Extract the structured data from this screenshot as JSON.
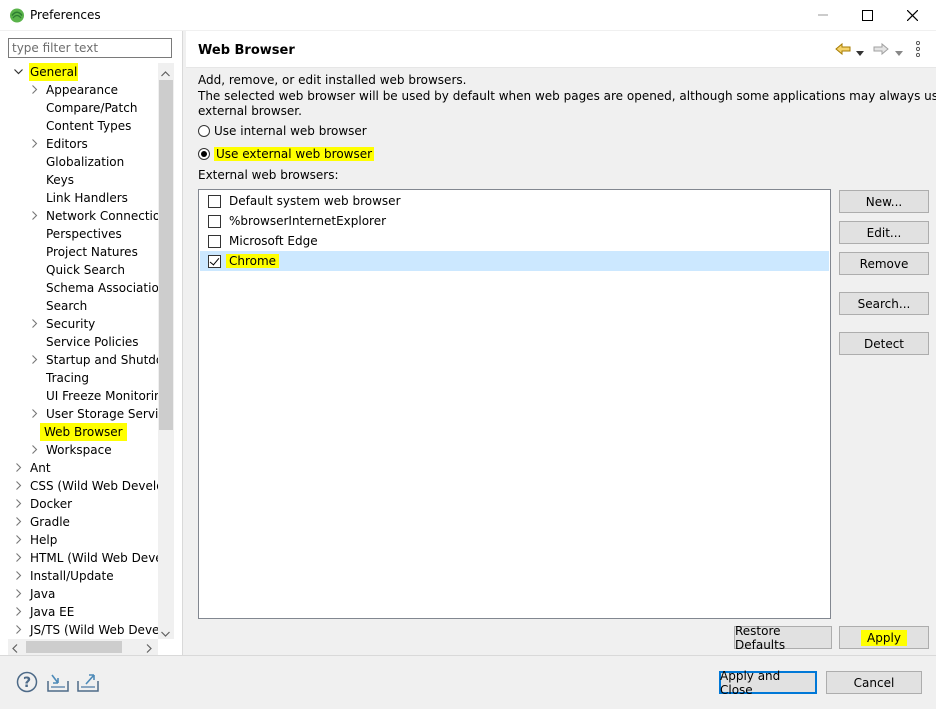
{
  "window": {
    "title": "Preferences"
  },
  "filter": {
    "placeholder": "type filter text"
  },
  "tree": [
    {
      "label": "General",
      "depth": 0,
      "expanded": true,
      "highlight": true
    },
    {
      "label": "Appearance",
      "depth": 1,
      "chevron": true
    },
    {
      "label": "Compare/Patch",
      "depth": 1
    },
    {
      "label": "Content Types",
      "depth": 1
    },
    {
      "label": "Editors",
      "depth": 1,
      "chevron": true
    },
    {
      "label": "Globalization",
      "depth": 1
    },
    {
      "label": "Keys",
      "depth": 1
    },
    {
      "label": "Link Handlers",
      "depth": 1
    },
    {
      "label": "Network Connection",
      "depth": 1,
      "chevron": true
    },
    {
      "label": "Perspectives",
      "depth": 1
    },
    {
      "label": "Project Natures",
      "depth": 1
    },
    {
      "label": "Quick Search",
      "depth": 1
    },
    {
      "label": "Schema Associations",
      "depth": 1
    },
    {
      "label": "Search",
      "depth": 1
    },
    {
      "label": "Security",
      "depth": 1,
      "chevron": true
    },
    {
      "label": "Service Policies",
      "depth": 1
    },
    {
      "label": "Startup and Shutdow",
      "depth": 1,
      "chevron": true
    },
    {
      "label": "Tracing",
      "depth": 1
    },
    {
      "label": "UI Freeze Monitoring",
      "depth": 1
    },
    {
      "label": "User Storage Service",
      "depth": 1,
      "chevron": true
    },
    {
      "label": "Web Browser",
      "depth": 1,
      "selected": true,
      "highlight": true
    },
    {
      "label": "Workspace",
      "depth": 1,
      "chevron": true
    },
    {
      "label": "Ant",
      "depth": 0,
      "chevron": true
    },
    {
      "label": "CSS (Wild Web Develop",
      "depth": 0,
      "chevron": true
    },
    {
      "label": "Docker",
      "depth": 0,
      "chevron": true
    },
    {
      "label": "Gradle",
      "depth": 0,
      "chevron": true
    },
    {
      "label": "Help",
      "depth": 0,
      "chevron": true
    },
    {
      "label": "HTML (Wild Web Develo",
      "depth": 0,
      "chevron": true
    },
    {
      "label": "Install/Update",
      "depth": 0,
      "chevron": true
    },
    {
      "label": "Java",
      "depth": 0,
      "chevron": true
    },
    {
      "label": "Java EE",
      "depth": 0,
      "chevron": true
    },
    {
      "label": "JS/TS (Wild Web Develc",
      "depth": 0,
      "chevron": true
    }
  ],
  "page": {
    "title": "Web Browser",
    "desc_line1": "Add, remove, or edit installed web browsers.",
    "desc_line2": "The selected web browser will be used by default when web pages are opened, although some applications may always use the",
    "desc_line3": "external browser.",
    "radio_internal": "Use internal web browser",
    "radio_external": "Use external web browser",
    "radio_selected": "external",
    "list_label": "External web browsers:",
    "browsers": [
      {
        "name": "Default system web browser",
        "checked": false
      },
      {
        "name": "%browserInternetExplorer",
        "checked": false
      },
      {
        "name": "Microsoft Edge",
        "checked": false
      },
      {
        "name": "Chrome",
        "checked": true,
        "selected": true,
        "highlight": true
      }
    ],
    "buttons": {
      "new": "New...",
      "edit": "Edit...",
      "remove": "Remove",
      "search": "Search...",
      "detect": "Detect"
    },
    "restore_defaults": "Restore Defaults",
    "apply": "Apply"
  },
  "footer": {
    "apply_close": "Apply and Close",
    "cancel": "Cancel"
  },
  "icons": {
    "help": "help-icon",
    "import": "import-icon",
    "export": "export-icon",
    "back": "back-arrow-icon",
    "forward": "forward-arrow-icon",
    "menu": "view-menu-icon"
  },
  "colors": {
    "highlight": "#ffff00",
    "selection": "#cce8ff",
    "accent": "#0078d7"
  }
}
